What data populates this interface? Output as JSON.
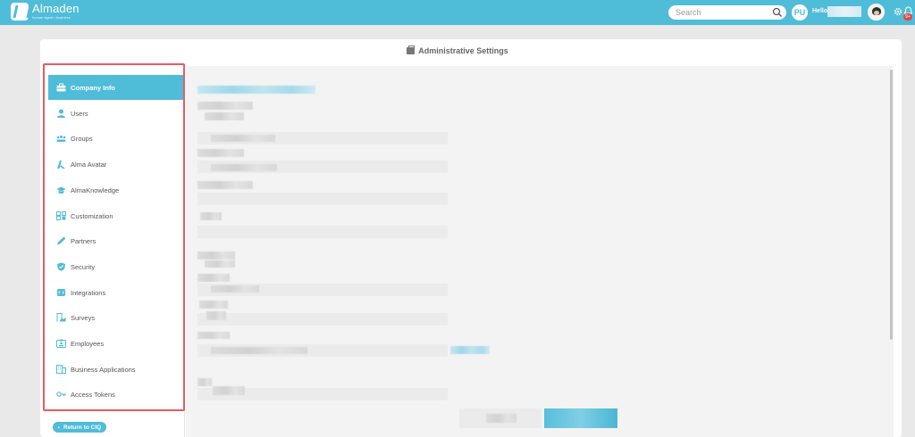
{
  "topbar": {
    "logo_name": "Almaden",
    "logo_tagline": "human agent • business",
    "search_placeholder": "Search",
    "user_initials": "PU",
    "greeting": "Hello",
    "notification_count": "9+"
  },
  "page": {
    "title": "Administrative Settings"
  },
  "sidebar": {
    "items": [
      {
        "label": "Company Info",
        "icon": "briefcase-icon",
        "active": true
      },
      {
        "label": "Users",
        "icon": "user-icon"
      },
      {
        "label": "Groups",
        "icon": "groups-icon"
      },
      {
        "label": "Alma Avatar",
        "icon": "alma-logo-icon"
      },
      {
        "label": "AlmaKnowledge",
        "icon": "graduation-cap-icon"
      },
      {
        "label": "Customization",
        "icon": "grid-icon"
      },
      {
        "label": "Partners",
        "icon": "pen-icon"
      },
      {
        "label": "Security",
        "icon": "shield-icon"
      },
      {
        "label": "Integrations",
        "icon": "integration-icon"
      },
      {
        "label": "Surveys",
        "icon": "survey-icon"
      },
      {
        "label": "Employees",
        "icon": "id-card-icon"
      },
      {
        "label": "Business Applications",
        "icon": "building-icon"
      },
      {
        "label": "Access Tokens",
        "icon": "key-icon"
      }
    ],
    "return_label": "Return to CIQ"
  },
  "colors": {
    "accent": "#4fbcd8",
    "highlight_border": "#e85a63",
    "notification_badge": "#e24a4a"
  }
}
